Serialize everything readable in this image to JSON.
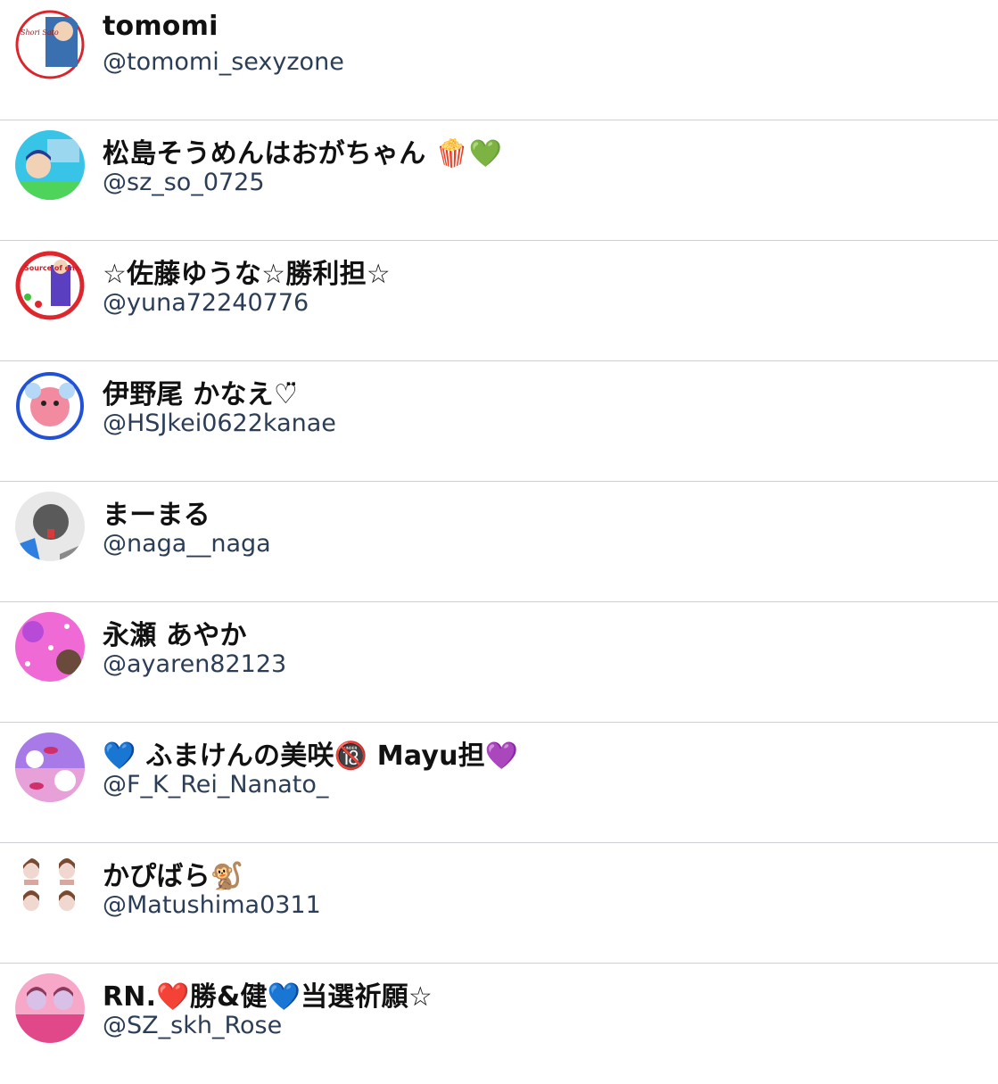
{
  "users": [
    {
      "name": "tomomi",
      "handle": "@tomomi_sexyzone",
      "avatar_colors": [
        "#ffffff",
        "#d9262c",
        "#3a6fb0",
        "#f2d2b6"
      ],
      "avatar_text": "Shori Sato"
    },
    {
      "name": "松島そうめんはおがちゃん 🍿💚",
      "handle": "@sz_so_0725",
      "avatar_colors": [
        "#37c4e6",
        "#4ed45a",
        "#9bd7ef",
        "#2a3b8f"
      ],
      "avatar_text": ""
    },
    {
      "name": "☆佐藤ゆうな☆勝利担☆",
      "handle": "@yuna72240776",
      "avatar_colors": [
        "#ffffff",
        "#e0262d",
        "#5a3fc0",
        "#3ec23a"
      ],
      "avatar_text": "Source of energy"
    },
    {
      "name": "伊野尾 かなえ♡̈",
      "handle": "@HSJkei0622kanae",
      "avatar_colors": [
        "#ffffff",
        "#2151d6",
        "#f28aa0",
        "#b5d8f6"
      ],
      "avatar_text": ""
    },
    {
      "name": "まーまる",
      "handle": "@naga__naga",
      "avatar_colors": [
        "#e8e8e8",
        "#5a5a5a",
        "#2e7fe0",
        "#d63b3b"
      ],
      "avatar_text": ""
    },
    {
      "name": "永瀬 あやか",
      "handle": "@ayaren82123",
      "avatar_colors": [
        "#f06ad6",
        "#b84ad8",
        "#ffffff",
        "#6a4a3a"
      ],
      "avatar_text": ""
    },
    {
      "name": "💙 ふまけんの美咲🔞 Mayu担💜",
      "handle": "@F_K_Rei_Nanato_",
      "avatar_colors": [
        "#a87ae8",
        "#e8a0d8",
        "#d0306a",
        "#ffffff"
      ],
      "avatar_text": ""
    },
    {
      "name": "かぴばら🐒",
      "handle": "@Matushima0311",
      "avatar_colors": [
        "#ffffff",
        "#7a4a30",
        "#d8a8a0",
        "#f0d8d0"
      ],
      "avatar_text": ""
    },
    {
      "name": "RN.❤️勝&健💙当選祈願☆",
      "handle": "@SZ_skh_Rose",
      "avatar_colors": [
        "#f7a8c8",
        "#e0488a",
        "#d8c0e8",
        "#8a3a5a"
      ],
      "avatar_text": ""
    }
  ]
}
